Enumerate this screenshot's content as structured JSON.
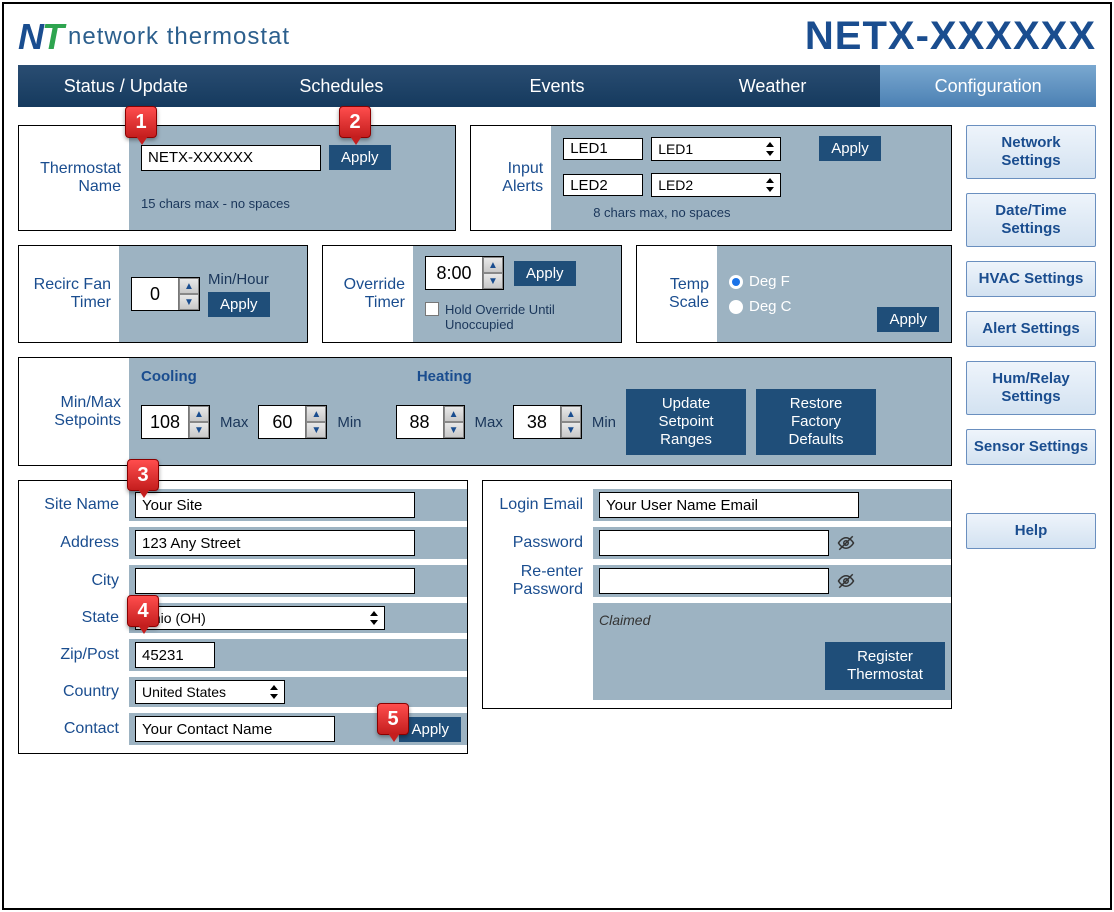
{
  "header": {
    "brand_left": "N",
    "brand_right": "T",
    "brand_text": "network thermostat",
    "device_title": "NETX-XXXXXX"
  },
  "nav": {
    "items": [
      "Status / Update",
      "Schedules",
      "Events",
      "Weather",
      "Configuration"
    ],
    "active_index": 4
  },
  "thermostat_name": {
    "label": "Thermostat Name",
    "value": "NETX-XXXXXX",
    "hint": "15 chars max - no spaces",
    "apply": "Apply"
  },
  "input_alerts": {
    "label": "Input Alerts",
    "rows": [
      {
        "text": "LED1",
        "select": "LED1"
      },
      {
        "text": "LED2",
        "select": "LED2"
      }
    ],
    "hint": "8 chars max, no spaces",
    "apply": "Apply"
  },
  "recirc": {
    "label": "Recirc Fan Timer",
    "value": "0",
    "unit": "Min/Hour",
    "apply": "Apply"
  },
  "override": {
    "label": "Override Timer",
    "value": "8:00",
    "apply": "Apply",
    "hold_label": "Hold Override Until Unoccupied",
    "hold_checked": false
  },
  "temp_scale": {
    "label": "Temp Scale",
    "options": [
      "Deg F",
      "Deg C"
    ],
    "selected": "Deg F",
    "apply": "Apply"
  },
  "setpoints": {
    "label": "Min/Max Setpoints",
    "cooling_label": "Cooling",
    "heating_label": "Heating",
    "cool_max": "108",
    "cool_min": "60",
    "heat_max": "88",
    "heat_min": "38",
    "max_lbl": "Max",
    "min_lbl": "Min",
    "update_btn": "Update Setpoint Ranges",
    "restore_btn": "Restore Factory Defaults"
  },
  "site": {
    "site_name_lbl": "Site Name",
    "site_name": "Your Site",
    "address_lbl": "Address",
    "address": "123 Any Street",
    "city_lbl": "City",
    "city": "",
    "state_lbl": "State",
    "state": "Ohio (OH)",
    "zip_lbl": "Zip/Post",
    "zip": "45231",
    "country_lbl": "Country",
    "country": "United States",
    "contact_lbl": "Contact",
    "contact": "Your Contact Name",
    "apply": "Apply"
  },
  "login": {
    "email_lbl": "Login Email",
    "email": "Your User Name Email",
    "pwd_lbl": "Password",
    "pwd": "",
    "pwd2_lbl": "Re-enter Password",
    "pwd2": "",
    "claimed": "Claimed",
    "register": "Register Thermostat"
  },
  "sidebar": {
    "items": [
      "Network Settings",
      "Date/Time Settings",
      "HVAC Settings",
      "Alert Settings",
      "Hum/Relay Settings",
      "Sensor Settings",
      "Help"
    ]
  },
  "callouts": {
    "c1": "1",
    "c2": "2",
    "c3": "3",
    "c4": "4",
    "c5": "5"
  }
}
